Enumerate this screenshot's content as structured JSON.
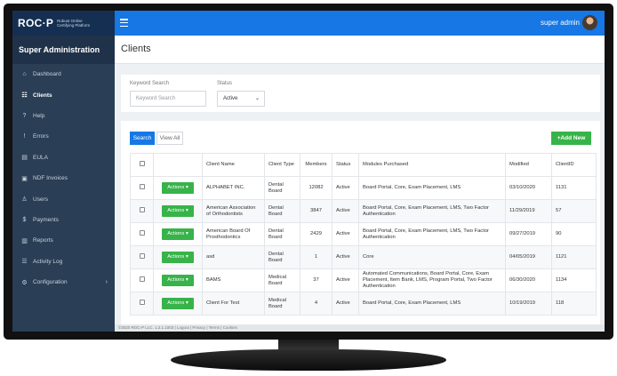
{
  "brand": {
    "logo": "ROC·P",
    "tagline": "Robust Online Certifying Platform"
  },
  "topbar": {
    "user_name": "super admin",
    "menu_icon": "hamburger-icon",
    "avatar_icon": "user-avatar"
  },
  "sidebar": {
    "title": "Super Administration",
    "items": [
      {
        "label": "Dashboard",
        "icon": "house-icon",
        "active": false
      },
      {
        "label": "Clients",
        "icon": "users-icon",
        "active": true
      },
      {
        "label": "Help",
        "icon": "question-icon",
        "active": false
      },
      {
        "label": "Errors",
        "icon": "exclamation-icon",
        "active": false
      },
      {
        "label": "EULA",
        "icon": "document-icon",
        "active": false
      },
      {
        "label": "NDF Invoices",
        "icon": "invoice-icon",
        "active": false
      },
      {
        "label": "Users",
        "icon": "user-icon",
        "active": false
      },
      {
        "label": "Payments",
        "icon": "dollar-icon",
        "active": false
      },
      {
        "label": "Reports",
        "icon": "bar-chart-icon",
        "active": false
      },
      {
        "label": "Activity Log",
        "icon": "list-icon",
        "active": false
      },
      {
        "label": "Configuration",
        "icon": "gear-icon",
        "active": false
      }
    ]
  },
  "page": {
    "title": "Clients"
  },
  "filters": {
    "keyword_label": "Keyword Search",
    "keyword_placeholder": "Keyword Search",
    "status_label": "Status",
    "status_value": "Active"
  },
  "buttons": {
    "search": "Search",
    "view_all": "View All",
    "add_new": "+Add New",
    "actions": "Actions ▾"
  },
  "table": {
    "columns": [
      "",
      "",
      "Client Name",
      "Client Type",
      "Members",
      "Status",
      "Modules Purchased",
      "Modified",
      "ClientID"
    ],
    "rows": [
      {
        "name": "ALPHABET INC.",
        "type": "Dental Board",
        "members": "12082",
        "status": "Active",
        "modules": "Board Portal, Core, Exam Placement, LMS",
        "modified": "03/10/2020",
        "id": "1131"
      },
      {
        "name": "American Association of Orthodontists",
        "type": "Dental Board",
        "members": "3847",
        "status": "Active",
        "modules": "Board Portal, Core, Exam Placement, LMS, Two Factor Authentication",
        "modified": "11/29/2019",
        "id": "57"
      },
      {
        "name": "American Board Of Prosthodontics",
        "type": "Dental Board",
        "members": "2429",
        "status": "Active",
        "modules": "Board Portal, Core, Exam Placement, LMS, Two Factor Authentication",
        "modified": "09/27/2019",
        "id": "90"
      },
      {
        "name": "asd",
        "type": "Dental Board",
        "members": "1",
        "status": "Active",
        "modules": "Core",
        "modified": "04/05/2019",
        "id": "1121"
      },
      {
        "name": "BAMS",
        "type": "Medical Board",
        "members": "37",
        "status": "Active",
        "modules": "Automated Communications, Board Portal, Core, Exam Placement, Item Bank, LMS, Program Portal, Two Factor Authentication",
        "modified": "06/30/2020",
        "id": "1134"
      },
      {
        "name": "Client For Test",
        "type": "Medical Board",
        "members": "4",
        "status": "Active",
        "modules": "Board Portal, Core, Exam Placement, LMS",
        "modified": "10/19/2019",
        "id": "118"
      }
    ]
  },
  "footer": {
    "text": "©2020 ROC-P LLC. 1.2.1.1003 | Logout | Privacy | Terms | Cookies"
  },
  "colors": {
    "topbar": "#1677e5",
    "sidebar": "#2a3e55",
    "brand_bg": "#142f52",
    "accent_green": "#37b34a"
  }
}
